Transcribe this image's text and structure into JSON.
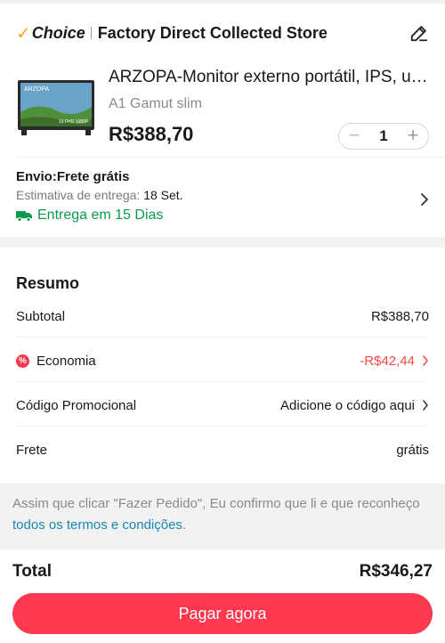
{
  "store": {
    "brand": "Choice",
    "name": "Factory Direct Collected Store"
  },
  "product": {
    "title": "ARZOPA-Monitor externo portátil, IPS, ult...",
    "variant": "A1 Gamut slim",
    "price": "R$388,70",
    "quantity": "1",
    "image_text": "ARZOPA",
    "image_subtext": "16 FHD 1080P"
  },
  "shipping": {
    "title": "Envio:Frete grátis",
    "estimate_label": "Estimativa de entrega:",
    "estimate_date": "18 Set.",
    "eta": "Entrega em 15 Dias"
  },
  "summary": {
    "title": "Resumo",
    "subtotal_label": "Subtotal",
    "subtotal_value": "R$388,70",
    "discount_label": "Economia",
    "discount_value": "-R$42,44",
    "promo_label": "Código Promocional",
    "promo_value": "Adicione o código aqui",
    "shipping_label": "Frete",
    "shipping_value": "grátis"
  },
  "terms": {
    "text": "Assim que clicar \"Fazer Pedido\", Eu confirmo que li e que reconheço ",
    "link": "todos os termos e condições",
    "end": "."
  },
  "footer": {
    "total_label": "Total",
    "total_value": "R$346,27",
    "pay_button": "Pagar agora"
  },
  "colors": {
    "accent": "#fd384f",
    "discount": "#ff4747",
    "eta_green": "#0a9b4e",
    "link": "#1a86b3",
    "choice_check": "#f5a623"
  },
  "icons": [
    "check-icon",
    "edit-icon",
    "minus-icon",
    "plus-icon",
    "truck-icon",
    "chevron-right-icon",
    "discount-icon"
  ]
}
